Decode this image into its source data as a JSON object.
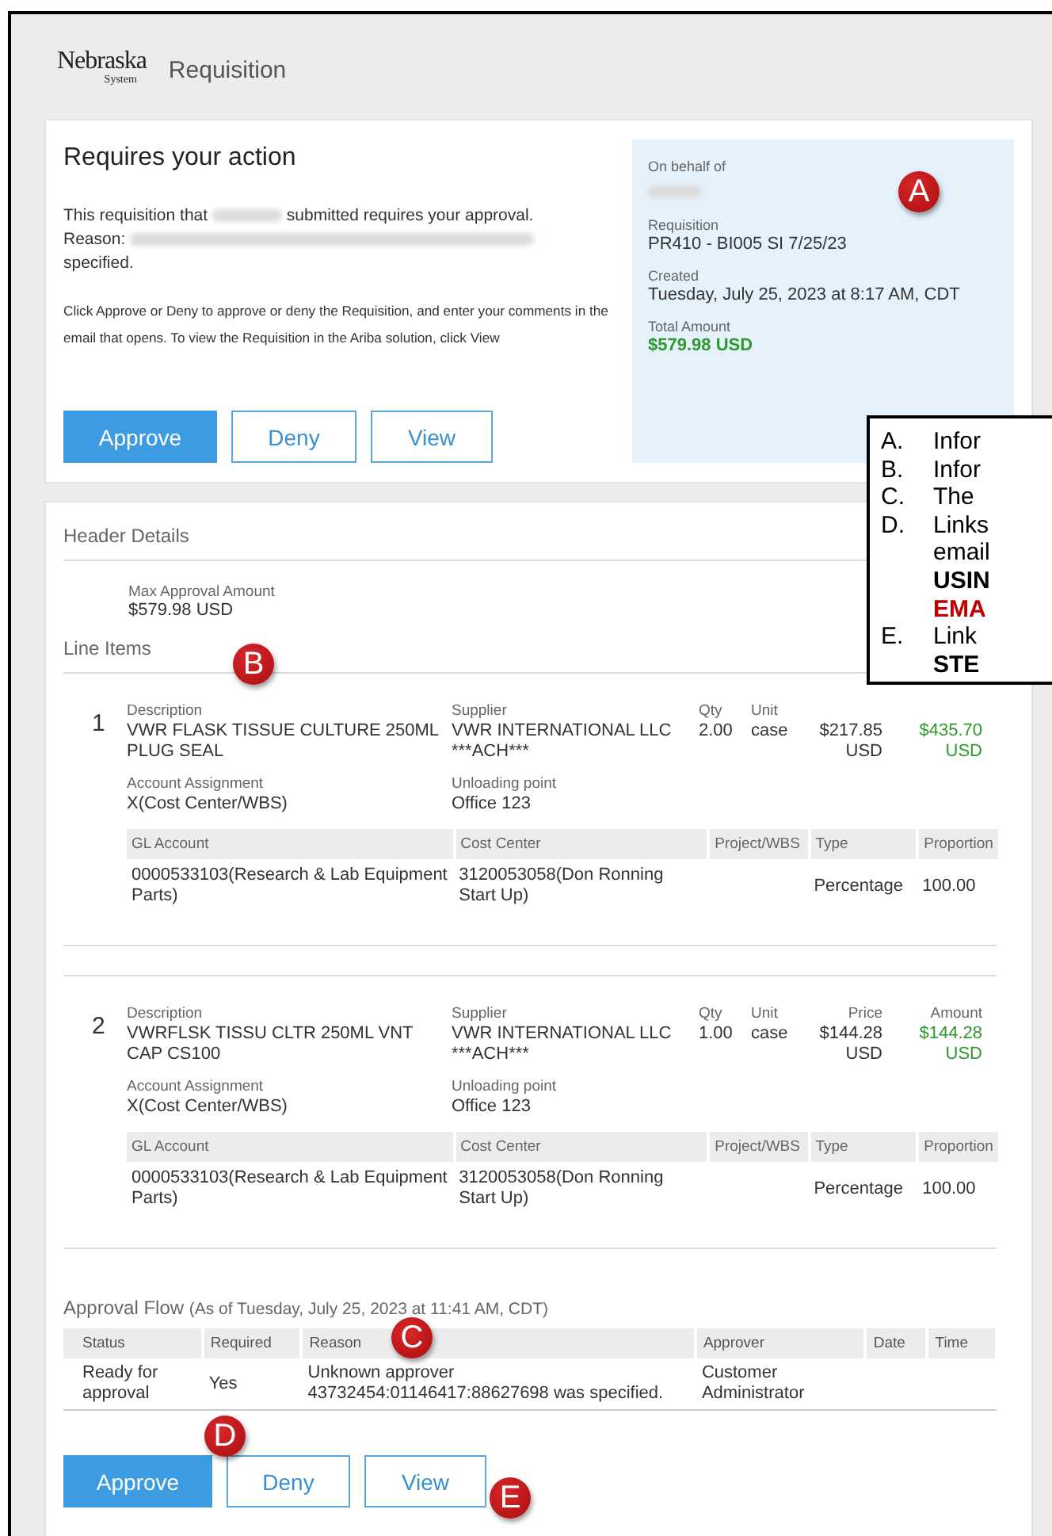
{
  "header": {
    "logo": {
      "name": "Nebraska",
      "sub": "System"
    },
    "title": "Requisition"
  },
  "action": {
    "title": "Requires your action",
    "intro_before": "This requisition that",
    "intro_after": "submitted requires your approval.",
    "reason_label": "Reason:",
    "reason_end": "specified.",
    "instructions": "Click Approve or Deny to approve or deny the Requisition, and enter your comments in the email that opens. To view the Requisition in the Ariba solution, click View",
    "summary": [
      {
        "label": "On behalf of",
        "kind": "redacted"
      },
      {
        "label": "Requisition",
        "kind": "text",
        "value": "PR410 - BI005 SI 7/25/23"
      },
      {
        "label": "Created",
        "kind": "text",
        "value": "Tuesday, July 25, 2023 at 8:17 AM, CDT"
      },
      {
        "label": "Total Amount",
        "kind": "amount",
        "value": "$579.98 USD"
      }
    ],
    "buttons": [
      {
        "label": "Approve",
        "kind": "primary"
      },
      {
        "label": "Deny",
        "kind": "secondary"
      },
      {
        "label": "View",
        "kind": "secondary"
      }
    ],
    "badge": "A"
  },
  "details": {
    "title": "Header Details",
    "max_label": "Max Approval Amount",
    "max_value": "$579.98 USD",
    "line_items_title": "Line Items",
    "badge": "B",
    "line_items": [
      {
        "number": "1",
        "labels": {
          "description": "Description",
          "supplier": "Supplier",
          "qty": "Qty",
          "unit": "Unit"
        },
        "description": [
          "VWR FLASK TISSUE CULTURE 250ML",
          "PLUG SEAL"
        ],
        "supplier": [
          "VWR INTERNATIONAL LLC",
          "***ACH***"
        ],
        "qty": "2.00",
        "unit": "case",
        "price": [
          "$217.85",
          "USD"
        ],
        "amount": [
          "$435.70",
          "USD"
        ],
        "account_label": "Account Assignment",
        "account": "X(Cost Center/WBS)",
        "unloading_label": "Unloading point",
        "unloading": "Office 123",
        "columns": [
          "GL Account",
          "Cost Center",
          "Project/WBS",
          "Type",
          "Proportion"
        ],
        "row": {
          "gl_account": "0000533103(Research & Lab Equipment Parts)",
          "cost_center": "3120053058(Don Ronning Start Up)",
          "type": "Percentage",
          "proportion": "100.00"
        }
      },
      {
        "number": "2",
        "labels": {
          "description": "Description",
          "supplier": "Supplier",
          "qty": "Qty",
          "unit": "Unit",
          "price": "Price",
          "amount": "Amount"
        },
        "description": [
          "VWRFLSK TISSU CLTR 250ML VNT",
          "CAP CS100"
        ],
        "supplier": [
          "VWR INTERNATIONAL LLC",
          "***ACH***"
        ],
        "qty": "1.00",
        "unit": "case",
        "price": [
          "$144.28",
          "USD"
        ],
        "amount": [
          "$144.28",
          "USD"
        ],
        "account_label": "Account Assignment",
        "account": "X(Cost Center/WBS)",
        "unloading_label": "Unloading point",
        "unloading": "Office 123",
        "columns": [
          "GL Account",
          "Cost Center",
          "Project/WBS",
          "Type",
          "Proportion"
        ],
        "row": {
          "gl_account": "0000533103(Research & Lab Equipment Parts)",
          "cost_center": "3120053058(Don Ronning Start Up)",
          "type": "Percentage",
          "proportion": "100.00"
        }
      }
    ]
  },
  "approval_flow": {
    "title": "Approval Flow",
    "subtitle": "(As of Tuesday, July 25, 2023 at 11:41 AM, CDT)",
    "badge": "C",
    "columns": [
      "Status",
      "Required",
      "Reason",
      "Approver",
      "Date",
      "Time"
    ],
    "rows": [
      {
        "status": "Ready for approval",
        "required": "Yes",
        "reason": "Unknown approver 43732454:01146417:88627698 was specified.",
        "approver": "Customer Administrator"
      }
    ],
    "buttons": [
      {
        "label": "Approve",
        "kind": "primary"
      },
      {
        "label": "Deny",
        "kind": "secondary"
      },
      {
        "label": "View",
        "kind": "secondary"
      }
    ],
    "badges": [
      "D",
      "E"
    ]
  },
  "callout": [
    {
      "letter": "A.",
      "lines": [
        {
          "text": "Infor",
          "kind": "normal"
        }
      ]
    },
    {
      "letter": "B.",
      "lines": [
        {
          "text": "Infor",
          "kind": "normal"
        }
      ]
    },
    {
      "letter": "C.",
      "lines": [
        {
          "text": "The",
          "kind": "normal"
        }
      ]
    },
    {
      "letter": "D.",
      "lines": [
        {
          "text": "Links",
          "kind": "normal"
        },
        {
          "text": "email",
          "kind": "normal"
        },
        {
          "text": "USIN",
          "kind": "emphasis"
        },
        {
          "text": "EMA",
          "kind": "warning"
        }
      ]
    },
    {
      "letter": "E.",
      "lines": [
        {
          "text": "Link",
          "kind": "normal"
        },
        {
          "text": "STE",
          "kind": "emphasis"
        }
      ]
    }
  ]
}
